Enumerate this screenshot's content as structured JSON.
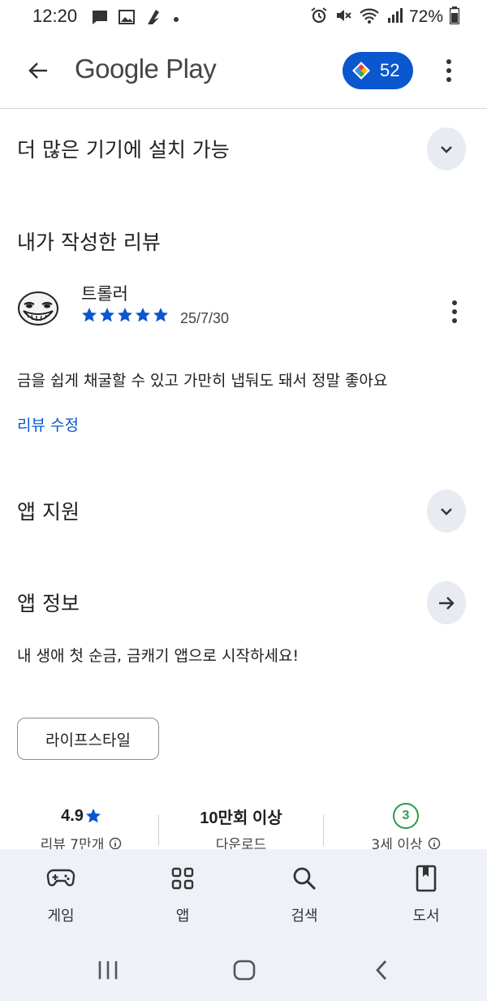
{
  "status_bar": {
    "time": "12:20",
    "battery": "72%"
  },
  "app_bar": {
    "title": "Google Play",
    "points": "52"
  },
  "sections": {
    "more_devices": "더 많은 기기에 설치 가능",
    "my_review": "내가 작성한 리뷰",
    "app_support": "앱 지원",
    "app_info": "앱 정보"
  },
  "review": {
    "reviewer": "트롤러",
    "rating": 5,
    "date": "25/7/30",
    "text": "금을 쉽게 채굴할 수 있고 가만히 냅둬도 돼서 정말 좋아요",
    "edit_label": "리뷰 수정"
  },
  "app_description": "내 생애 첫 순금, 금캐기 앱으로 시작하세요!",
  "category_chip": "라이프스타일",
  "stats": {
    "rating_value": "4.9",
    "rating_label": "리뷰 7만개",
    "downloads_value": "10만회 이상",
    "downloads_label": "다운로드",
    "age_value": "3",
    "age_label": "3세 이상"
  },
  "bottom_nav": {
    "games": "게임",
    "apps": "앱",
    "search": "검색",
    "books": "도서"
  },
  "colors": {
    "accent": "#0b57d0",
    "age_green": "#2e9b4a",
    "nav_bg": "#eef1f7"
  }
}
